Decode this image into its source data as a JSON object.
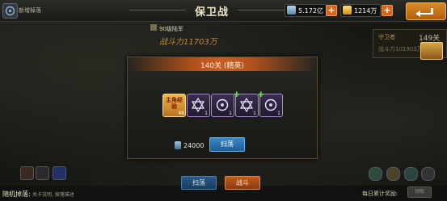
{
  "topbar": {
    "corner_label": "新增掉落",
    "title": "保卫战",
    "currency_silver": "5.172亿",
    "currency_gold": "1214万"
  },
  "banner": {
    "level": "90级陆军",
    "power": "战斗力11703万"
  },
  "enemy_panel": {
    "label": "守卫者",
    "level": "149关",
    "power": "战斗力101903万"
  },
  "dialog": {
    "title": "140关 (精英)",
    "rewards": {
      "exp_label": "主角经验",
      "exp_count": "48",
      "rune_counts": [
        "1",
        "1",
        "1",
        "1"
      ]
    },
    "cost": "24000",
    "sweep_button": "扫荡"
  },
  "bottom": {
    "drop_label": "随机掉落:",
    "drop_desc": "关卡说明, 掉落描述",
    "sweep_button": "扫荡",
    "fight_button": "战斗",
    "daily_label": "每日累计奖励:",
    "claim_button": "领取"
  },
  "colors": {
    "accent_orange": "#c75e22",
    "sweep_blue": "#2a74b4",
    "rune_purple": "#a885d8",
    "exp_gold": "#f0b84a"
  }
}
